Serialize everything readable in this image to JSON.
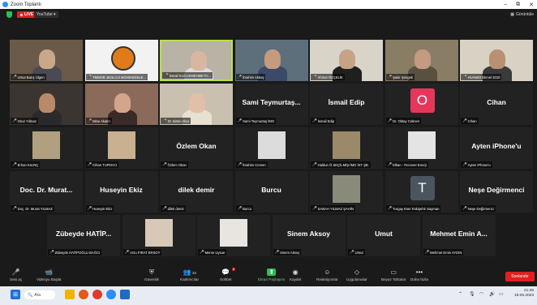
{
  "window": {
    "title": "Zoom Toplantı",
    "controls": [
      "–",
      "⧉",
      "✕"
    ]
  },
  "topbar": {
    "live": "LIVE",
    "stream": "YouTube ▾",
    "view": "Görüntüle"
  },
  "tiles": [
    {
      "label": "Umut Barış Ülgen",
      "type": "video",
      "bg": "#6b5a4a",
      "skin": "#c9a88a",
      "shirt": "#4a4a52"
    },
    {
      "label": "TMMOB JEOLOJİ MÜHENDİSLE...",
      "type": "logo",
      "bg": "#f2f2f2"
    },
    {
      "label": "İsmail KUCUKMEHMETO...",
      "type": "video",
      "bg": "#b9b3a5",
      "skin": "#d8b6a0",
      "shirt": "#dcdcdc",
      "active": true
    },
    {
      "label": "İbrahim Akkuş",
      "type": "video",
      "bg": "#5d6f7a",
      "skin": "#c59a7e",
      "shirt": "#3a4a68"
    },
    {
      "label": "Ahmet ÖZÇELİK",
      "type": "video",
      "bg": "#d9d4c8",
      "skin": "#c7a385",
      "shirt": "#1f1f1f"
    },
    {
      "label": "Şakir Şengek",
      "type": "video",
      "bg": "#8a7d66",
      "skin": "#c49b80",
      "shirt": "#5a5040"
    },
    {
      "label": "HUAWEI Ekmel 2010",
      "type": "video",
      "bg": "#d8d2c4",
      "skin": "#b99073",
      "shirt": "#3b3b3b"
    },
    {
      "label": "Onur Yılmaz",
      "type": "video",
      "bg": "#3a3530",
      "skin": "#b98a6a",
      "shirt": "#2a2a2a"
    },
    {
      "label": "Mine Akalın",
      "type": "video",
      "bg": "#8c6a5a",
      "skin": "#d3a58c",
      "shirt": "#3a2a28"
    },
    {
      "label": "Dr. Birsin Akın",
      "type": "video",
      "bg": "#c9c0b0",
      "skin": "#e0c0a8",
      "shirt": "#e8e0d0"
    },
    {
      "label": "Sami Teymurtaş İMO",
      "type": "name",
      "name": "Sami Teymurtaş..."
    },
    {
      "label": "İsmail Edip",
      "type": "name",
      "name": "İsmail Edip"
    },
    {
      "label": "Dr. Oktay Celmen",
      "type": "avatar",
      "letter": "O",
      "color": "#e5375b"
    },
    {
      "label": "Cihan",
      "type": "name",
      "name": "Cihan"
    },
    {
      "label": "Erhan KILINÇ",
      "type": "photo",
      "bg": "#b0a080"
    },
    {
      "label": "Cihan TUFEKCI",
      "type": "photo",
      "bg": "#c8b090"
    },
    {
      "label": "Özlem Okan",
      "type": "name",
      "name": "Özlem Okan"
    },
    {
      "label": "İbrahim Cemen",
      "type": "photo",
      "bg": "#dcdcdc"
    },
    {
      "label": "Haldun Ö.SEÇİLMİŞ-İMO İST ŞB.",
      "type": "photo",
      "bg": "#9a8a6a"
    },
    {
      "label": "Elkan - Recover Enerji",
      "type": "photo",
      "bg": "#e4e4e4"
    },
    {
      "label": "Ayten iPhone'u",
      "type": "name",
      "name": "Ayten iPhone'u"
    },
    {
      "label": "Doç. Dr. Murat YILMAZ",
      "type": "name",
      "name": "Doc. Dr. Murat..."
    },
    {
      "label": "Huseyin Ekiz",
      "type": "name",
      "name": "Huseyin Ekiz"
    },
    {
      "label": "dilek demir",
      "type": "name",
      "name": "dilek demir"
    },
    {
      "label": "Burcu",
      "type": "name",
      "name": "Burcu"
    },
    {
      "label": "SABAH YILMAZ ŞAHİN",
      "type": "photo",
      "bg": "#8a8a7a"
    },
    {
      "label": "Turgay Eser Eskişehir Sayman",
      "type": "avatar",
      "letter": "T",
      "color": "#4a5560"
    },
    {
      "label": "Neşe Değirmenci",
      "type": "name",
      "name": "Neşe Değirmenci"
    },
    {
      "label": "Zübeyde HATİPOĞLU BAĞCI",
      "type": "name",
      "name": "Zübeyde HATİP..."
    },
    {
      "label": "Arzu FIRAT ERSOY",
      "type": "photo",
      "bg": "#d8c8b8"
    },
    {
      "label": "Merve Uysun",
      "type": "photo",
      "bg": "#e8e4e0"
    },
    {
      "label": "Sinem Aksoy",
      "type": "name",
      "name": "Sinem Aksoy"
    },
    {
      "label": "Umut",
      "type": "name",
      "name": "Umut"
    },
    {
      "label": "Mehmet Emin AYDIN",
      "type": "name",
      "name": "Mehmet Emin A..."
    }
  ],
  "toolbar": {
    "items": [
      {
        "label": "Sesi aç",
        "icon": "mic-off-icon"
      },
      {
        "label": "Videoyu Başlat",
        "icon": "video-off-icon"
      },
      {
        "label": "Güvenlik",
        "icon": "shield-icon"
      },
      {
        "label": "Katılımcılar",
        "icon": "participants-icon",
        "count": "34"
      },
      {
        "label": "Sohbet",
        "icon": "chat-icon",
        "badge": "2"
      },
      {
        "label": "Ekran Paylaşımı",
        "icon": "share-screen-icon"
      },
      {
        "label": "Kaydet",
        "icon": "record-icon"
      },
      {
        "label": "Reaksiyonlar",
        "icon": "reactions-icon"
      },
      {
        "label": "Uygulamalar",
        "icon": "apps-icon"
      },
      {
        "label": "Beyaz Tahtalar",
        "icon": "whiteboard-icon"
      },
      {
        "label": "Daha fazla",
        "icon": "more-icon"
      }
    ],
    "end": "Sonlandır"
  },
  "taskbar": {
    "search": "Ara",
    "time": "21:45",
    "date": "19.06.2023"
  }
}
